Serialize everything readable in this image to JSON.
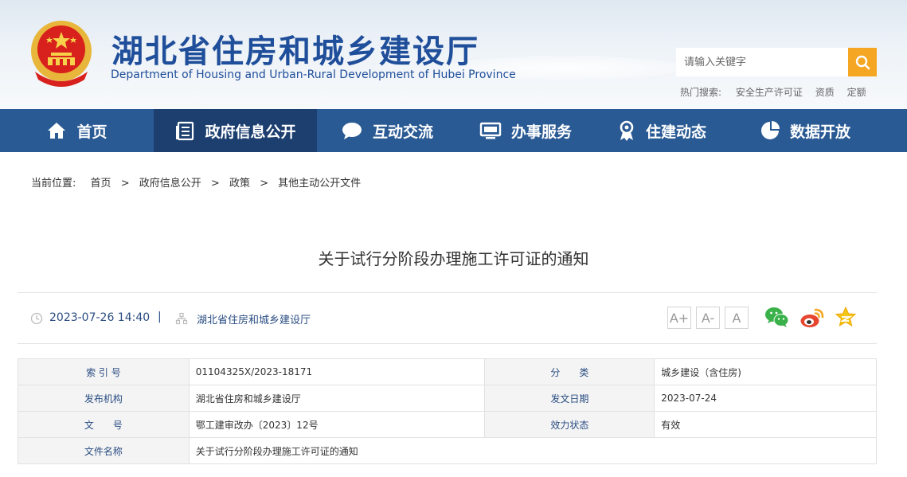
{
  "header": {
    "title": "湖北省住房和城乡建设厅",
    "subtitle": "Department of Housing and Urban-Rural Development of Hubei Province",
    "emblem_icon": "national-emblem-icon"
  },
  "search": {
    "placeholder": "请输入关键字",
    "button_icon": "search-icon",
    "button_color": "#f5a623"
  },
  "hot_search": {
    "label": "热门搜索:",
    "items": [
      "安全生产许可证",
      "资质",
      "定额"
    ]
  },
  "nav": {
    "color": "#2a5a94",
    "active_color": "#1c3f70",
    "items": [
      {
        "label": "首页",
        "icon": "home-icon",
        "active": false
      },
      {
        "label": "政府信息公开",
        "icon": "document-list-icon",
        "active": true
      },
      {
        "label": "互动交流",
        "icon": "chat-bubble-icon",
        "active": false
      },
      {
        "label": "办事服务",
        "icon": "monitor-icon",
        "active": false
      },
      {
        "label": "住建动态",
        "icon": "award-icon",
        "active": false
      },
      {
        "label": "数据开放",
        "icon": "pie-chart-icon",
        "active": false
      }
    ]
  },
  "breadcrumb": {
    "label": "当前位置:",
    "items": [
      "首页",
      "政府信息公开",
      "政策",
      "其他主动公开文件"
    ],
    "separator": ">"
  },
  "article": {
    "title": "关于试行分阶段办理施工许可证的通知",
    "datetime": "2023-07-26 14:40",
    "divider": "|",
    "source": "湖北省住房和城乡建设厅"
  },
  "font_buttons": [
    "A+",
    "A-",
    "A"
  ],
  "share_icons": [
    "wechat-icon",
    "weibo-icon",
    "favorite-star-icon"
  ],
  "info_table": {
    "rows": [
      [
        {
          "label": "索 引 号",
          "value": "01104325X/2023-18171"
        },
        {
          "label": "分　　类",
          "value": "城乡建设（含住房)"
        }
      ],
      [
        {
          "label": "发布机构",
          "value": "湖北省住房和城乡建设厅"
        },
        {
          "label": "发文日期",
          "value": "2023-07-24"
        }
      ],
      [
        {
          "label": "文　　号",
          "value": "鄂工建审改办〔2023〕12号"
        },
        {
          "label": "效力状态",
          "value": "有效"
        }
      ],
      [
        {
          "label": "文件名称",
          "value": "关于试行分阶段办理施工许可证的通知"
        }
      ]
    ]
  }
}
